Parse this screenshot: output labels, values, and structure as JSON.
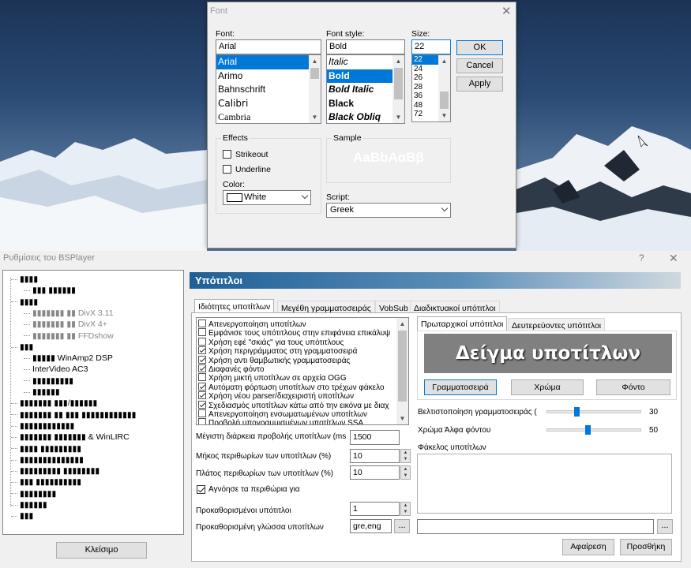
{
  "font_dialog": {
    "title": "Font",
    "font_label": "Font:",
    "font_value": "Arial",
    "font_items": [
      "Arial",
      "Arimo",
      "Bahnschrift",
      "Calibri",
      "Cambria"
    ],
    "selected_font": "Arial",
    "style_label": "Font style:",
    "style_value": "Bold",
    "style_items": [
      "Italic",
      "Bold",
      "Bold Italic",
      "Black",
      "Black Obliq"
    ],
    "selected_style": "Bold",
    "size_label": "Size:",
    "size_value": "22",
    "size_items": [
      "22",
      "24",
      "26",
      "28",
      "36",
      "48",
      "72"
    ],
    "selected_size": "22",
    "ok": "OK",
    "cancel": "Cancel",
    "apply": "Apply",
    "effects_label": "Effects",
    "strikeout": "Strikeout",
    "underline": "Underline",
    "color_label": "Color:",
    "color_value": "White",
    "sample_label": "Sample",
    "sample_text": "AaBbAαBβ",
    "script_label": "Script:",
    "script_value": "Greek"
  },
  "bsplayer": {
    "title": "Ρυθμίσεις του BSPlayer",
    "help": "?",
    "close": "✕",
    "tree": [
      {
        "label": "▮▮▮▮",
        "indent": 0,
        "gray": false
      },
      {
        "label": "▮▮▮ ▮▮▮▮▮▮",
        "indent": 1,
        "gray": false
      },
      {
        "label": "▮▮▮▮",
        "indent": 0,
        "gray": false
      },
      {
        "label": "▮▮▮▮▮▮▮ ▮▮ DivX 3.11",
        "indent": 1,
        "gray": true
      },
      {
        "label": "▮▮▮▮▮▮▮ ▮▮ DivX 4+",
        "indent": 1,
        "gray": true
      },
      {
        "label": "▮▮▮▮▮▮▮ ▮▮ FFDshow",
        "indent": 1,
        "gray": true
      },
      {
        "label": "▮▮▮",
        "indent": 0,
        "gray": false
      },
      {
        "label": "▮▮▮▮▮ WinAmp2 DSP",
        "indent": 1,
        "gray": false
      },
      {
        "label": "InterVideo AC3",
        "indent": 1,
        "gray": false
      },
      {
        "label": "▮▮▮▮▮▮▮▮▮",
        "indent": 1,
        "gray": false
      },
      {
        "label": "▮▮▮▮▮▮",
        "indent": 1,
        "gray": false
      },
      {
        "label": "▮▮▮▮▮▮▮ ▮▮▮/▮▮▮▮▮▮",
        "indent": 0,
        "gray": false
      },
      {
        "label": "▮▮▮▮▮▮▮ ▮▮ ▮▮▮ ▮▮▮▮▮▮▮▮▮▮▮▮",
        "indent": 0,
        "gray": false
      },
      {
        "label": "▮▮▮▮▮▮▮▮▮▮▮▮",
        "indent": 0,
        "gray": false
      },
      {
        "label": "▮▮▮▮▮▮▮ ▮▮▮▮▮▮▮ & WinLIRC",
        "indent": 0,
        "gray": false
      },
      {
        "label": "▮▮▮▮ ▮▮▮▮▮▮▮▮▮",
        "indent": 0,
        "gray": false
      },
      {
        "label": "▮▮▮▮▮▮▮▮▮▮▮▮▮▮",
        "indent": 0,
        "gray": false
      },
      {
        "label": "▮▮▮▮▮▮▮▮▮ ▮▮▮▮▮▮▮▮",
        "indent": 0,
        "gray": false
      },
      {
        "label": "▮▮▮ ▮▮▮▮▮▮▮▮▮▮",
        "indent": 0,
        "gray": false
      },
      {
        "label": "▮▮▮▮▮▮▮▮",
        "indent": 0,
        "gray": false
      },
      {
        "label": "▮▮▮▮▮▮",
        "indent": 0,
        "gray": false
      },
      {
        "label": "▮▮▮",
        "indent": 0,
        "gray": false
      }
    ],
    "close_button": "Κλείσιμο",
    "section_title": "Υπότιτλοι",
    "tabs": [
      "Ιδιότητες υποτίτλων",
      "Μεγέθη γραμματοσειράς",
      "VobSub",
      "Διαδικτυακοί υπότιτλοι"
    ],
    "options": [
      {
        "label": "Απενεργοποίηση υποτίτλων",
        "checked": false
      },
      {
        "label": "Εμφάνισε τους υπότιτλους στην επιφάνεια επικάλυψ",
        "checked": false
      },
      {
        "label": "Χρήση εφέ \"σκιάς\" για τους υπότιτλους",
        "checked": false
      },
      {
        "label": "Χρήση περιγράμματος στη γραμματοσειρά",
        "checked": true
      },
      {
        "label": "Χρήση αντι θαμβωτικής γραμματοσειράς",
        "checked": true
      },
      {
        "label": "Διαφανές φόντο",
        "checked": true
      },
      {
        "label": "Χρήση μικτή υποτίτλων σε αρχεία OGG",
        "checked": false
      },
      {
        "label": "Αυτόματη φόρτωση υποτίτλων στο τρέχων φάκελο",
        "checked": true
      },
      {
        "label": "Χρήση νέου parser/διαχειριστή υποτίτλων",
        "checked": true
      },
      {
        "label": "Σχεδιασμός υποτίτλων κάτω από την εικόνα με διαχ",
        "checked": true
      },
      {
        "label": "Απενεργοποίηση ενσωματωμένων υποτίτλων",
        "checked": false
      },
      {
        "label": "Προβολή υπογραμμισμένων υποτίτλων SSA",
        "checked": false
      }
    ],
    "max_duration_label": "Μέγιστη διάρκεια προβολής υποτίτλων (ms",
    "max_duration_value": "1500",
    "margin_len_label": "Μήκος περιθωρίων των υποτίτλων (%)",
    "margin_len_value": "10",
    "margin_width_label": "Πλάτος περιθωρίων των υποτίτλων (%)",
    "margin_width_value": "10",
    "ignore_margins_label": "Αγνόησε τα περιθώρια για",
    "default_subs_label": "Προκαθορισμένοι υπότιτλοι",
    "default_subs_value": "1",
    "default_lang_label": "Προκαθορισμένη γλώσσα υποτίτλων",
    "default_lang_value": "gre,eng",
    "browse": "...",
    "subtabs": [
      "Πρωταρχικοί υπότιτλοι",
      "Δευτερεύοντες υπότιτλοι"
    ],
    "preview_text": "Δείγμα υποτίτλων",
    "font_btn": "Γραμματοσειρά",
    "color_btn": "Χρώμα",
    "bg_btn": "Φόντο",
    "opt_font_label": "Βελτιστοποίηση γραμματοσειράς (",
    "opt_font_value": "30",
    "alpha_label": "Χρώμα Άλφα φόντου",
    "alpha_value": "50",
    "folders_label": "Φάκελος υποτίτλων",
    "remove_btn": "Αφαίρεση",
    "add_btn": "Προσθήκη"
  }
}
